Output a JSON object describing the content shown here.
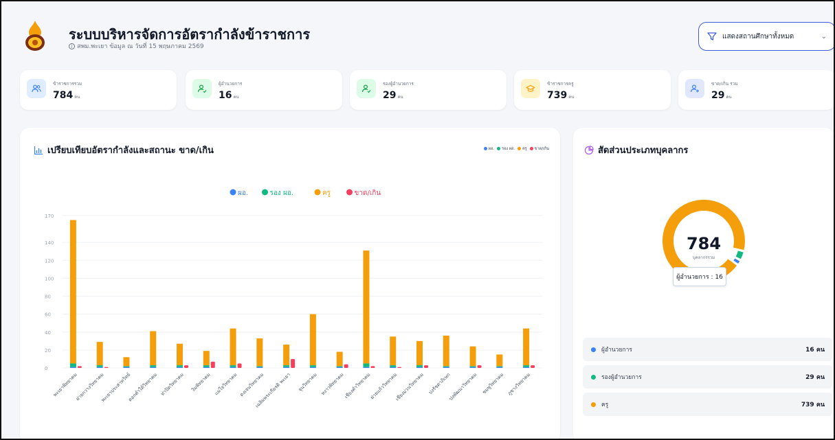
{
  "header": {
    "title": "ระบบบริหารจัดการอัตรากำลังข้าราชการ",
    "subtitle": "สพม.พะเยา ข้อมูล ณ วันที่ 15 พฤษภาคม 2569",
    "school_filter": "แสดงสถานศึกษาทั้งหมด"
  },
  "stats": [
    {
      "label": "ข้าราชการรวม",
      "value": "784",
      "unit": "คน",
      "icon": "users-icon",
      "color": "#3b82f6"
    },
    {
      "label": "ผู้อำนวยการ",
      "value": "16",
      "unit": "คน",
      "icon": "user-check-icon",
      "color": "#16a34a"
    },
    {
      "label": "รองผู้อำนวยการ",
      "value": "29",
      "unit": "คน",
      "icon": "user-check-icon",
      "color": "#16a34a"
    },
    {
      "label": "ข้าราชการครู",
      "value": "739",
      "unit": "คน",
      "icon": "graduation-cap-icon",
      "color": "#f59e0b"
    },
    {
      "label": "ขาด/เกิน รวม",
      "value": "29",
      "unit": "คน",
      "icon": "user-plus-icon",
      "color": "#3b82f6"
    }
  ],
  "chart_panel": {
    "title": "เปรียบเทียบอัตรากำลังและสถานะ ขาด/เกิน",
    "mini_legend": [
      "ผอ.",
      "รอง ผอ.",
      "ครู",
      "ขาด/เกิน"
    ]
  },
  "donut_panel": {
    "title": "สัดส่วนประเภทบุคลากร",
    "total": "784",
    "total_label": "บุคลากรรวม",
    "tooltip": "ผู้อำนวยการ : 16",
    "rows": [
      {
        "name": "ผู้อำนวยการ",
        "count": "16 คน",
        "color": "#3b82f6"
      },
      {
        "name": "รองผู้อำนวยการ",
        "count": "29 คน",
        "color": "#10b981"
      },
      {
        "name": "ครู",
        "count": "739 คน",
        "color": "#f59e0b"
      }
    ]
  },
  "chart_data": {
    "type": "bar",
    "stacked": true,
    "legend": [
      "ผอ.",
      "รอง ผอ.",
      "ครู",
      "ขาด/เกิน"
    ],
    "legend_position": "top-center",
    "colors": {
      "director": "#3b82f6",
      "deputy": "#10b981",
      "teacher": "#f59e0b",
      "shortage": "#f43f5e"
    },
    "yticks": [
      0,
      20,
      40,
      60,
      80,
      100,
      120,
      140,
      170
    ],
    "ylim": [
      0,
      170
    ],
    "grid": true,
    "categories": [
      "พะเยาพิทยาคม",
      "ฝายกวางวิทยาคม",
      "พะเยาประสาทวิทย์",
      "ดอกคำใต้วิทยาคม",
      "ท่าปิดวิทยาคม",
      "งิมพิทยาคม",
      "แม่ใจวิทยาคม",
      "ดงเจนวิทยาคม",
      "เฉลิมพระเกียรติ พะเยา",
      "จุนวิทยาคม",
      "หงาวพิทยาคม",
      "เชียงคำวิทยาคม",
      "ฝายแก้ววิทยาคม",
      "เชียงม่วนวิทยาคม",
      "ปงรัชดาภิเษก",
      "ปงพัฒนาวิทยาคม",
      "ชมพูวิทยาคม",
      "ภูซางวิทยาคม"
    ],
    "series": [
      {
        "name": "ผอ.",
        "values": [
          1,
          1,
          1,
          1,
          1,
          1,
          1,
          1,
          1,
          1,
          1,
          1,
          1,
          1,
          1,
          1,
          1,
          1
        ]
      },
      {
        "name": "รอง ผอ.",
        "values": [
          4,
          2,
          1,
          2,
          2,
          2,
          2,
          1,
          2,
          2,
          1,
          4,
          2,
          2,
          1,
          1,
          1,
          2
        ]
      },
      {
        "name": "ครู",
        "values": [
          160,
          26,
          10,
          38,
          24,
          16,
          41,
          31,
          23,
          57,
          16,
          126,
          32,
          27,
          34,
          22,
          13,
          41
        ]
      },
      {
        "name": "ขาด/เกิน",
        "values": [
          2,
          1,
          0,
          0,
          3,
          7,
          5,
          0,
          10,
          0,
          4,
          2,
          1,
          3,
          0,
          3,
          0,
          3
        ]
      }
    ]
  }
}
